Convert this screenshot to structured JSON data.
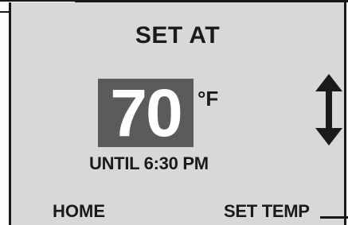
{
  "display": {
    "title": "SET AT",
    "temperature": "70",
    "unit": "°F",
    "until": "UNTIL 6:30 PM"
  },
  "softkeys": {
    "left": "HOME",
    "right": "SET TEMP"
  },
  "icons": {
    "adjust": "up-down-arrow-icon"
  },
  "colors": {
    "screen": "#d8d8d8",
    "temp_box": "#5b5b5b",
    "text": "#1a1a1a"
  }
}
